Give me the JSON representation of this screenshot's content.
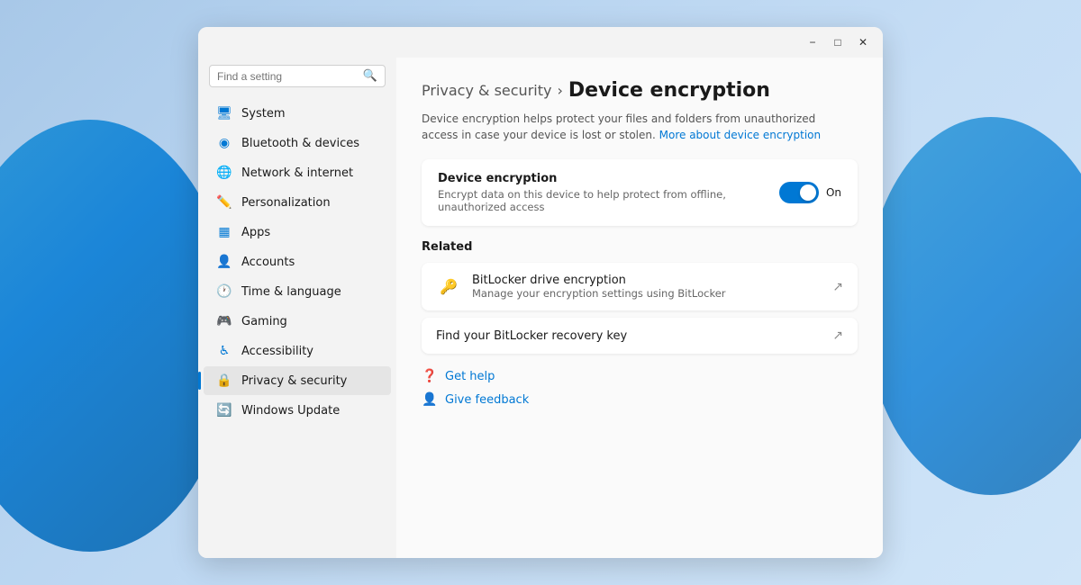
{
  "window": {
    "titlebar": {
      "minimize_label": "−",
      "maximize_label": "□",
      "close_label": "✕"
    }
  },
  "sidebar": {
    "search_placeholder": "Find a setting",
    "items": [
      {
        "id": "system",
        "label": "System",
        "icon": "🖥",
        "active": false
      },
      {
        "id": "bluetooth",
        "label": "Bluetooth & devices",
        "icon": "🔵",
        "active": false
      },
      {
        "id": "network",
        "label": "Network & internet",
        "icon": "🌐",
        "active": false
      },
      {
        "id": "personalization",
        "label": "Personalization",
        "icon": "✏️",
        "active": false
      },
      {
        "id": "apps",
        "label": "Apps",
        "icon": "📦",
        "active": false
      },
      {
        "id": "accounts",
        "label": "Accounts",
        "icon": "👤",
        "active": false
      },
      {
        "id": "time",
        "label": "Time & language",
        "icon": "🕐",
        "active": false
      },
      {
        "id": "gaming",
        "label": "Gaming",
        "icon": "🎮",
        "active": false
      },
      {
        "id": "accessibility",
        "label": "Accessibility",
        "icon": "♿",
        "active": false
      },
      {
        "id": "privacy",
        "label": "Privacy & security",
        "icon": "🔒",
        "active": true
      },
      {
        "id": "update",
        "label": "Windows Update",
        "icon": "🔄",
        "active": false
      }
    ]
  },
  "main": {
    "breadcrumb": {
      "parent": "Privacy & security",
      "separator": "›",
      "current": "Device encryption"
    },
    "description": "Device encryption helps protect your files and folders from unauthorized access in case your device is lost or stolen.",
    "description_link": "More about device encryption",
    "encryption_section": {
      "title": "Device encryption",
      "description": "Encrypt data on this device to help protect from offline, unauthorized access",
      "toggle_state": "On",
      "toggle_on": true
    },
    "related_section": {
      "label": "Related",
      "items": [
        {
          "id": "bitlocker",
          "title": "BitLocker drive encryption",
          "description": "Manage your encryption settings using BitLocker",
          "icon": "🔑"
        },
        {
          "id": "recovery",
          "title": "Find your BitLocker recovery key",
          "description": ""
        }
      ]
    },
    "help_links": [
      {
        "id": "get-help",
        "label": "Get help",
        "icon": "❓"
      },
      {
        "id": "give-feedback",
        "label": "Give feedback",
        "icon": "👤"
      }
    ]
  }
}
